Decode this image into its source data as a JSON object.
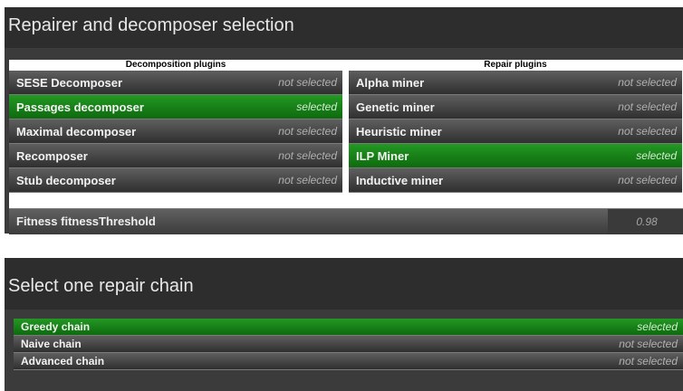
{
  "decomposition_panel": {
    "title": "Repairer and decomposer selection",
    "left_header": "Decomposition plugins",
    "right_header": "Repair plugins",
    "decomposition_plugins": [
      {
        "label": "SESE Decomposer",
        "status": "not selected"
      },
      {
        "label": "Passages decomposer",
        "status": "selected"
      },
      {
        "label": "Maximal decomposer",
        "status": "not selected"
      },
      {
        "label": "Recomposer",
        "status": "not selected"
      },
      {
        "label": "Stub decomposer",
        "status": "not selected"
      }
    ],
    "repair_plugins": [
      {
        "label": "Alpha miner",
        "status": "not selected"
      },
      {
        "label": "Genetic miner",
        "status": "not selected"
      },
      {
        "label": "Heuristic miner",
        "status": "not selected"
      },
      {
        "label": "ILP Miner",
        "status": "selected"
      },
      {
        "label": "Inductive miner",
        "status": "not selected"
      }
    ],
    "threshold": {
      "label": "Fitness fitnessThreshold",
      "value": "0.98"
    }
  },
  "chain_panel": {
    "title": "Select one repair chain",
    "chains": [
      {
        "label": "Greedy chain",
        "status": "selected"
      },
      {
        "label": "Naive chain",
        "status": "not selected"
      },
      {
        "label": "Advanced chain",
        "status": "not selected"
      }
    ]
  },
  "colors": {
    "selected": "#1a8a1a",
    "panel": "#3b3b3b",
    "title_bar": "#2d2d2d"
  }
}
